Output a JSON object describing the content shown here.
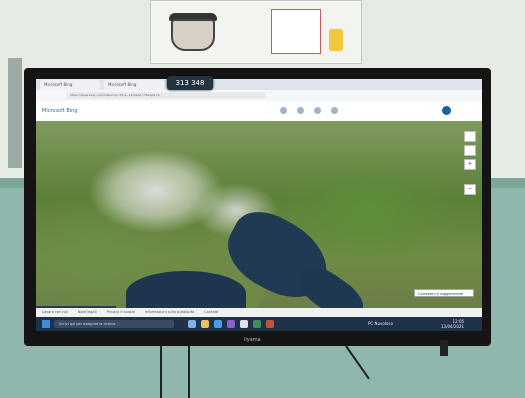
{
  "overlay": {
    "counter": "313 348"
  },
  "browser": {
    "tabs": [
      "Microsoft Bing",
      "Microsoft Bing"
    ],
    "address": "https://www.bing.com/maps?cp=45.0~12.0&lvl=7&style=a"
  },
  "bing": {
    "logo": "Microsoft Bing"
  },
  "map": {
    "suggest_button": "Correzioni e suggerimenti",
    "ctrl_plus": "+",
    "ctrl_minus": "−"
  },
  "bottom_links": [
    "Lavora con noi",
    "Note legali",
    "Privacy e cookie",
    "Informazioni sulla pubblicità",
    "Contatti"
  ],
  "taskbar": {
    "search_placeholder": "Scrivi qui per eseguire la ricerca",
    "tray": "PC Nuvoloso",
    "time": "12:05",
    "date": "13/04/2021"
  },
  "tv_brand": "iiyama",
  "colors": {
    "taskbar": "#20324a",
    "accent": "#3a8de0"
  }
}
